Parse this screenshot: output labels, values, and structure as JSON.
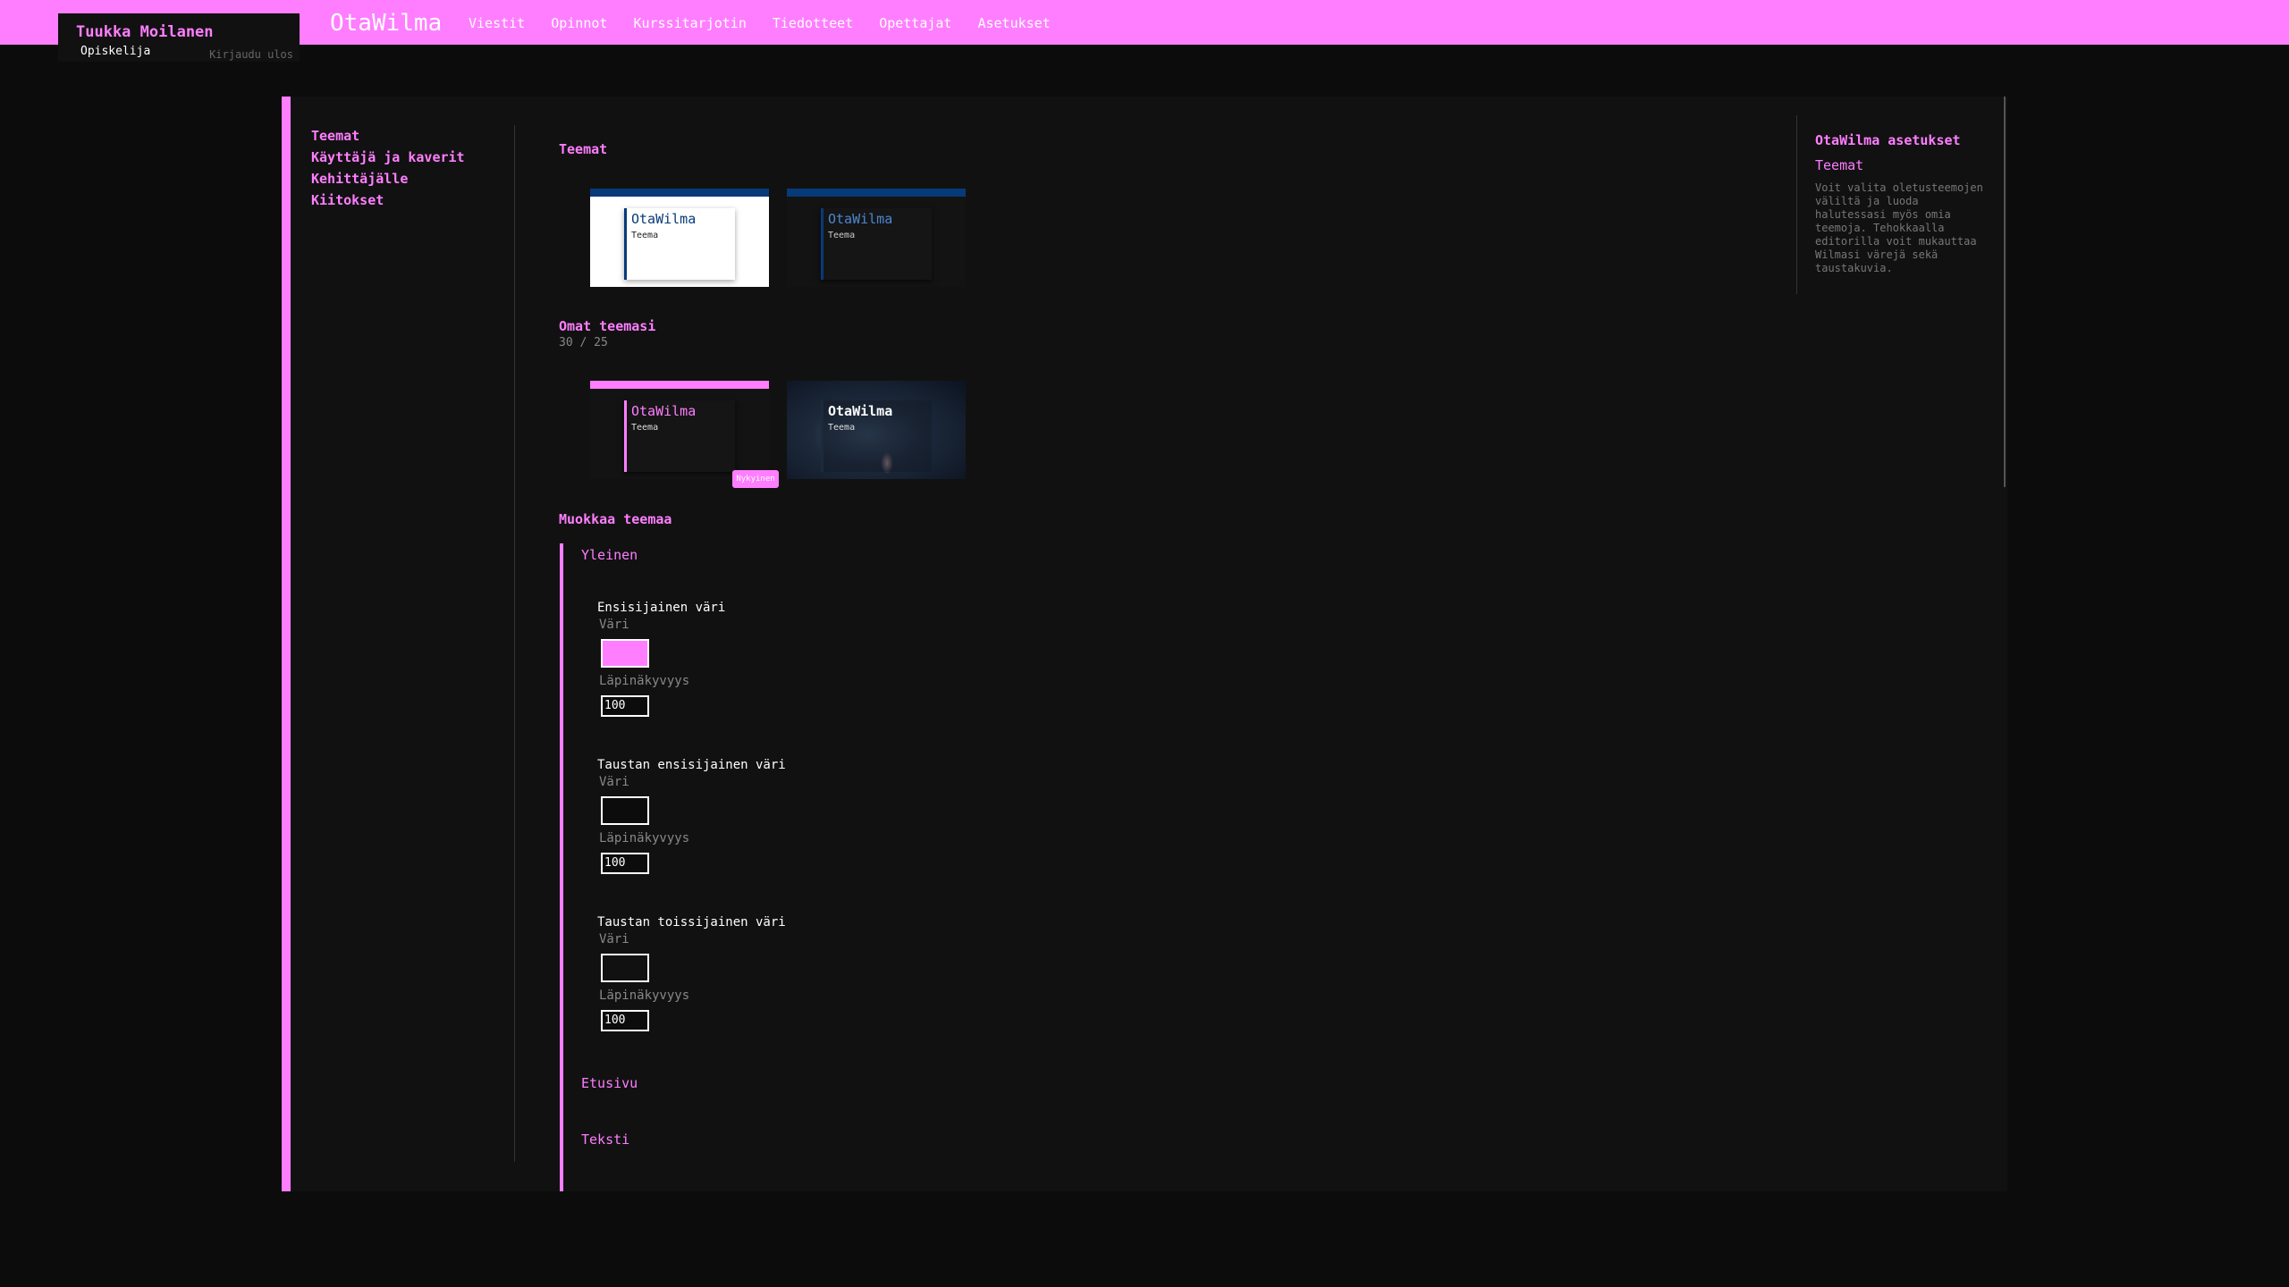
{
  "user": {
    "name": "Tuukka Moilanen",
    "role": "Opiskelija",
    "logout": "Kirjaudu ulos"
  },
  "brand": "OtaWilma",
  "nav": [
    "Viestit",
    "Opinnot",
    "Kurssitarjotin",
    "Tiedotteet",
    "Opettajat",
    "Asetukset"
  ],
  "sidebar": [
    "Teemat",
    "Käyttäjä ja kaverit",
    "Kehittäjälle",
    "Kiitokset"
  ],
  "themes": {
    "title": "Teemat",
    "defaults": [
      {
        "title": "OtaWilma",
        "subtitle": "Teema"
      },
      {
        "title": "OtaWilma",
        "subtitle": "Teema"
      }
    ],
    "own_title": "Omat teemasi",
    "own_count": "30 / 25",
    "own": [
      {
        "title": "OtaWilma",
        "subtitle": "Teema",
        "badge": "Nykyinen"
      },
      {
        "title": "OtaWilma",
        "subtitle": "Teema"
      }
    ]
  },
  "editor": {
    "title": "Muokkaa teemaa",
    "group_general": "Yleinen",
    "fields": [
      {
        "title": "Ensisijainen väri",
        "color_label": "Väri",
        "color": "#ff7eff",
        "opacity_label": "Läpinäkyvyys",
        "opacity": "100"
      },
      {
        "title": "Taustan ensisijainen väri",
        "color_label": "Väri",
        "color": "#0c0c0c",
        "opacity_label": "Läpinäkyvyys",
        "opacity": "100"
      },
      {
        "title": "Taustan toissijainen väri",
        "color_label": "Väri",
        "color": "#111111",
        "opacity_label": "Läpinäkyvyys",
        "opacity": "100"
      }
    ],
    "group_frontpage": "Etusivu",
    "group_text": "Teksti"
  },
  "info": {
    "title": "OtaWilma asetukset",
    "subtitle": "Teemat",
    "text": "Voit valita oletusteemojen väliltä ja luoda halutessasi myös omia teemoja. Tehokkaalla editorilla voit mukauttaa Wilmasi värejä sekä taustakuvia."
  },
  "colors": {
    "accent": "#ff7eff",
    "background": "#0c0c0c",
    "panel": "#111111",
    "blue": "#073a78"
  }
}
